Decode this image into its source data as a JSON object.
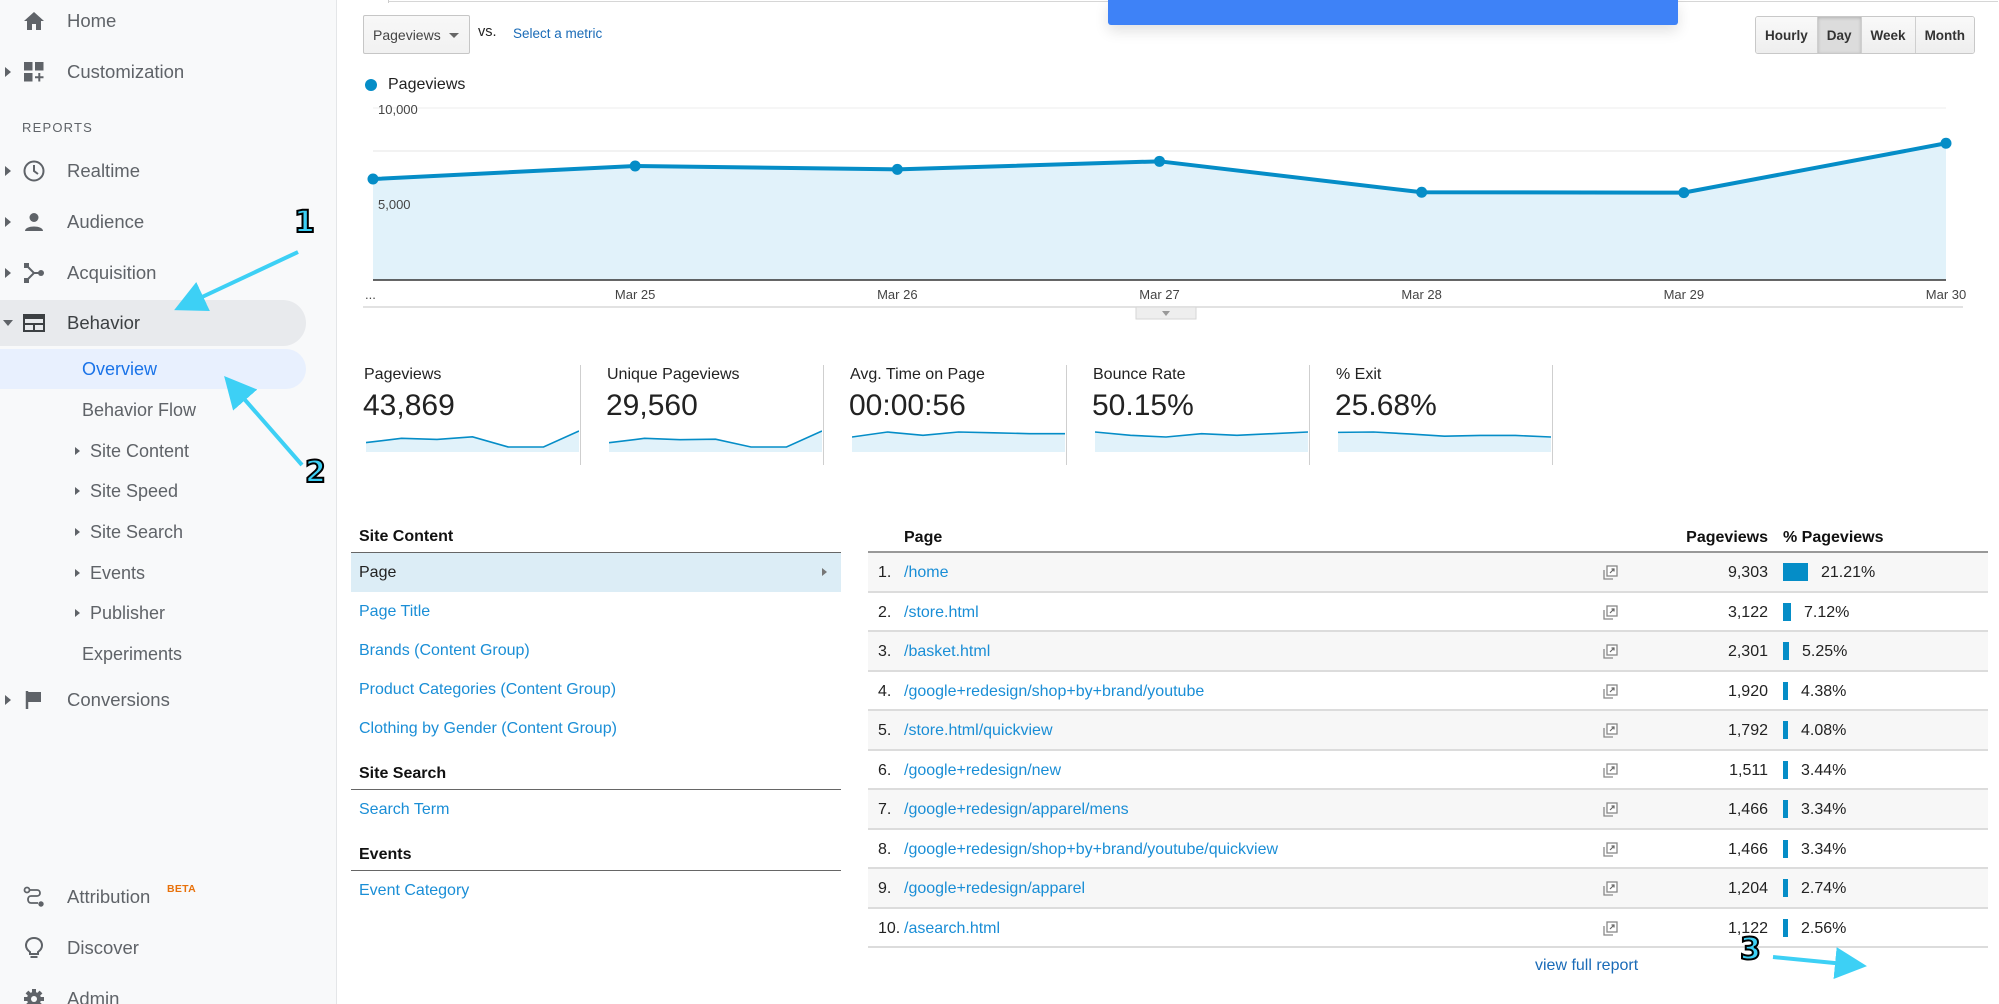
{
  "sidebar": {
    "top_items": [
      {
        "label": "Home",
        "icon": "home-icon"
      },
      {
        "label": "Customization",
        "icon": "customization-icon"
      }
    ],
    "reports_header": "REPORTS",
    "report_items": [
      {
        "label": "Realtime",
        "icon": "clock-icon"
      },
      {
        "label": "Audience",
        "icon": "person-icon"
      },
      {
        "label": "Acquisition",
        "icon": "acquisition-icon"
      },
      {
        "label": "Behavior",
        "icon": "behavior-icon"
      }
    ],
    "behavior_sub": [
      {
        "label": "Overview",
        "active": true
      },
      {
        "label": "Behavior Flow"
      },
      {
        "label": "Site Content",
        "expandable": true
      },
      {
        "label": "Site Speed",
        "expandable": true
      },
      {
        "label": "Site Search",
        "expandable": true
      },
      {
        "label": "Events",
        "expandable": true
      },
      {
        "label": "Publisher",
        "expandable": true
      },
      {
        "label": "Experiments"
      }
    ],
    "conversions": {
      "label": "Conversions",
      "icon": "flag-icon"
    },
    "bottom_items": [
      {
        "label": "Attribution",
        "badge": "BETA",
        "icon": "attribution-icon"
      },
      {
        "label": "Discover",
        "icon": "lightbulb-icon"
      },
      {
        "label": "Admin",
        "icon": "gear-icon"
      }
    ]
  },
  "annotations": [
    "1",
    "2",
    "3"
  ],
  "toolbar": {
    "metric_select": "Pageviews",
    "vs_label": "vs.",
    "select_metric": "Select a metric",
    "granularity": [
      "Hourly",
      "Day",
      "Week",
      "Month"
    ],
    "granularity_active": "Day"
  },
  "chart_data": {
    "type": "area",
    "legend": "Pageviews",
    "x": [
      "...",
      "Mar 25",
      "Mar 26",
      "Mar 27",
      "Mar 28",
      "Mar 29",
      "Mar 30"
    ],
    "series": [
      {
        "name": "Pageviews",
        "values": [
          5870,
          6630,
          6430,
          6900,
          5100,
          5080,
          7950
        ],
        "color": "#058dc7"
      }
    ],
    "ylim": [
      0,
      10000
    ],
    "yticks": [
      {
        "value": 10000,
        "label": "10,000"
      },
      {
        "value": 5000,
        "label": "5,000"
      }
    ],
    "grid": true
  },
  "scorecards": [
    {
      "label": "Pageviews",
      "value": "43,869",
      "spark": [
        5870,
        6630,
        6430,
        6900,
        5100,
        5080,
        7950
      ]
    },
    {
      "label": "Unique Pageviews",
      "value": "29,560",
      "spark": [
        3950,
        4450,
        4300,
        4350,
        3450,
        3450,
        5300
      ]
    },
    {
      "label": "Avg. Time on Page",
      "value": "00:00:56",
      "spark": [
        52,
        58,
        54,
        58,
        57,
        56,
        56
      ]
    },
    {
      "label": "Bounce Rate",
      "value": "50.15%",
      "spark": [
        50.3,
        50.1,
        50.0,
        50.2,
        50.1,
        50.2,
        50.3
      ]
    },
    {
      "label": "% Exit",
      "value": "25.68%",
      "spark": [
        26.2,
        26.3,
        25.8,
        25.2,
        25.4,
        25.4,
        25.0
      ]
    }
  ],
  "site_content_nav": {
    "sections": [
      {
        "title": "Site Content",
        "items": [
          {
            "label": "Page",
            "selected": true
          },
          {
            "label": "Page Title"
          },
          {
            "label": "Brands (Content Group)"
          },
          {
            "label": "Product Categories (Content Group)"
          },
          {
            "label": "Clothing by Gender (Content Group)"
          }
        ]
      },
      {
        "title": "Site Search",
        "items": [
          {
            "label": "Search Term"
          }
        ]
      },
      {
        "title": "Events",
        "items": [
          {
            "label": "Event Category"
          }
        ]
      }
    ]
  },
  "table": {
    "headers": {
      "page": "Page",
      "pageviews": "Pageviews",
      "pct": "% Pageviews"
    },
    "rows": [
      {
        "num": "1.",
        "page": "/home",
        "pageviews": "9,303",
        "pct": "21.21%",
        "pct_value": 21.21
      },
      {
        "num": "2.",
        "page": "/store.html",
        "pageviews": "3,122",
        "pct": "7.12%",
        "pct_value": 7.12
      },
      {
        "num": "3.",
        "page": "/basket.html",
        "pageviews": "2,301",
        "pct": "5.25%",
        "pct_value": 5.25
      },
      {
        "num": "4.",
        "page": "/google+redesign/shop+by+brand/youtube",
        "pageviews": "1,920",
        "pct": "4.38%",
        "pct_value": 4.38
      },
      {
        "num": "5.",
        "page": "/store.html/quickview",
        "pageviews": "1,792",
        "pct": "4.08%",
        "pct_value": 4.08
      },
      {
        "num": "6.",
        "page": "/google+redesign/new",
        "pageviews": "1,511",
        "pct": "3.44%",
        "pct_value": 3.44
      },
      {
        "num": "7.",
        "page": "/google+redesign/apparel/mens",
        "pageviews": "1,466",
        "pct": "3.34%",
        "pct_value": 3.34
      },
      {
        "num": "8.",
        "page": "/google+redesign/shop+by+brand/youtube/quickview",
        "pageviews": "1,466",
        "pct": "3.34%",
        "pct_value": 3.34
      },
      {
        "num": "9.",
        "page": "/google+redesign/apparel",
        "pageviews": "1,204",
        "pct": "2.74%",
        "pct_value": 2.74
      },
      {
        "num": "10.",
        "page": "/asearch.html",
        "pageviews": "1,122",
        "pct": "2.56%",
        "pct_value": 2.56
      }
    ],
    "view_full_report": "view full report"
  }
}
